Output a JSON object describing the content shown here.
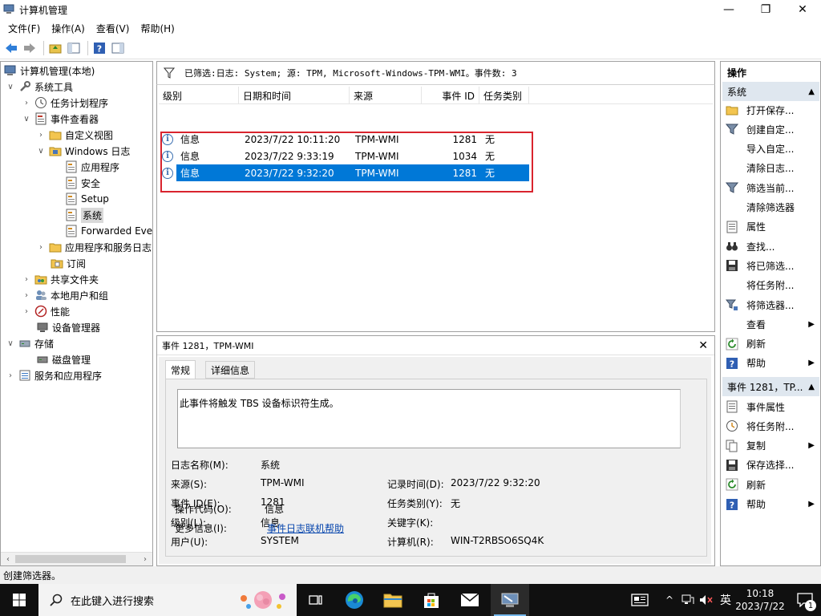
{
  "window": {
    "title": "计算机管理",
    "controls": {
      "minimize": "—",
      "maximize": "❐",
      "close": "✕"
    }
  },
  "menubar": [
    {
      "label": "文件(F)"
    },
    {
      "label": "操作(A)"
    },
    {
      "label": "查看(V)"
    },
    {
      "label": "帮助(H)"
    }
  ],
  "tree": {
    "items": [
      {
        "label": "计算机管理(本地)",
        "icon": "computer-management-icon"
      },
      {
        "label": "系统工具",
        "icon": "tools-icon"
      },
      {
        "label": "任务计划程序",
        "icon": "clock-icon"
      },
      {
        "label": "事件查看器",
        "icon": "event-viewer-icon"
      },
      {
        "label": "自定义视图",
        "icon": "folder-icon"
      },
      {
        "label": "Windows 日志",
        "icon": "folder-icon"
      },
      {
        "label": "应用程序",
        "icon": "log-icon"
      },
      {
        "label": "安全",
        "icon": "log-icon"
      },
      {
        "label": "Setup",
        "icon": "log-icon"
      },
      {
        "label": "系统",
        "icon": "log-icon"
      },
      {
        "label": "Forwarded Eve",
        "icon": "log-icon"
      },
      {
        "label": "应用程序和服务日志",
        "icon": "folder-icon"
      },
      {
        "label": "订阅",
        "icon": "subscription-icon"
      },
      {
        "label": "共享文件夹",
        "icon": "shared-folder-icon"
      },
      {
        "label": "本地用户和组",
        "icon": "users-icon"
      },
      {
        "label": "性能",
        "icon": "performance-icon"
      },
      {
        "label": "设备管理器",
        "icon": "device-manager-icon"
      },
      {
        "label": "存储",
        "icon": "storage-icon"
      },
      {
        "label": "磁盘管理",
        "icon": "disk-icon"
      },
      {
        "label": "服务和应用程序",
        "icon": "services-icon"
      }
    ]
  },
  "filter": {
    "text": "已筛选:日志: System; 源: TPM, Microsoft-Windows-TPM-WMI。事件数: 3"
  },
  "list": {
    "columns": [
      "级别",
      "日期和时间",
      "来源",
      "事件 ID",
      "任务类别"
    ],
    "rows": [
      {
        "level": "信息",
        "datetime": "2023/7/22 10:11:20",
        "source": "TPM-WMI",
        "event_id": "1281",
        "category": "无"
      },
      {
        "level": "信息",
        "datetime": "2023/7/22 9:33:19",
        "source": "TPM-WMI",
        "event_id": "1034",
        "category": "无"
      },
      {
        "level": "信息",
        "datetime": "2023/7/22 9:32:20",
        "source": "TPM-WMI",
        "event_id": "1281",
        "category": "无"
      }
    ]
  },
  "detail": {
    "header": "事件 1281，TPM-WMI",
    "tabs": [
      "常规",
      "详细信息"
    ],
    "description": "此事件将触发 TBS 设备标识符生成。",
    "fields": {
      "log_name_label": "日志名称(M):",
      "log_name": "系统",
      "source_label": "来源(S):",
      "source": "TPM-WMI",
      "logged_label": "记录时间(D):",
      "logged": "2023/7/22 9:32:20",
      "event_id_label": "事件 ID(E):",
      "event_id": "1281",
      "category_label": "任务类别(Y):",
      "category": "无",
      "level_label": "级别(L):",
      "level": "信息",
      "keywords_label": "关键字(K):",
      "user_label": "用户(U):",
      "user": "SYSTEM",
      "computer_label": "计算机(R):",
      "computer": "WIN-T2RBSO6SQ4K",
      "opcode_label": "操作代码(O):",
      "opcode": "信息",
      "more_info_label": "更多信息(I):",
      "more_info_link": "事件日志联机帮助"
    }
  },
  "actions": {
    "title": "操作",
    "section1": "系统",
    "section1_items": [
      {
        "label": "打开保存...",
        "icon": "open-folder-icon"
      },
      {
        "label": "创建自定...",
        "icon": "filter-icon"
      },
      {
        "label": "导入自定...",
        "icon": ""
      },
      {
        "label": "清除日志...",
        "icon": ""
      },
      {
        "label": "筛选当前...",
        "icon": "filter-icon"
      },
      {
        "label": "清除筛选器",
        "icon": ""
      },
      {
        "label": "属性",
        "icon": "properties-icon"
      },
      {
        "label": "查找...",
        "icon": "binoculars-icon"
      },
      {
        "label": "将已筛选...",
        "icon": "save-icon"
      },
      {
        "label": "将任务附...",
        "icon": ""
      },
      {
        "label": "将筛选器...",
        "icon": "filter-save-icon"
      },
      {
        "label": "查看",
        "icon": "",
        "submenu": true
      },
      {
        "label": "刷新",
        "icon": "refresh-icon"
      },
      {
        "label": "帮助",
        "icon": "help-icon",
        "submenu": true
      }
    ],
    "section2": "事件 1281，TP...",
    "section2_items": [
      {
        "label": "事件属性",
        "icon": "properties-icon"
      },
      {
        "label": "将任务附...",
        "icon": "task-icon"
      },
      {
        "label": "复制",
        "icon": "copy-icon",
        "submenu": true
      },
      {
        "label": "保存选择...",
        "icon": "save-icon"
      },
      {
        "label": "刷新",
        "icon": "refresh-icon"
      },
      {
        "label": "帮助",
        "icon": "help-icon",
        "submenu": true
      }
    ]
  },
  "status": {
    "text": "创建筛选器。"
  },
  "taskbar": {
    "search_placeholder": "在此键入进行搜索",
    "time": "10:18",
    "date": "2023/7/22",
    "ime": "英",
    "notification_count": "1"
  },
  "colors": {
    "selection": "#0078d7",
    "highlight_box": "#d9242e",
    "section_bg": "#dfe7ef",
    "taskbar": "#101010"
  }
}
